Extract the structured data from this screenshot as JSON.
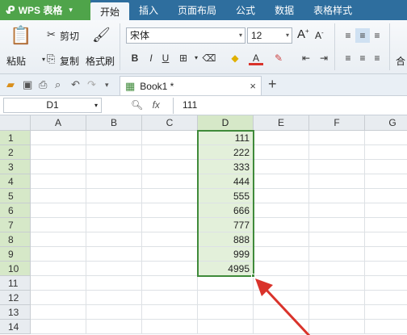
{
  "app": {
    "name": "WPS 表格"
  },
  "menu": [
    "开始",
    "插入",
    "页面布局",
    "公式",
    "数据",
    "表格样式"
  ],
  "ribbon": {
    "paste": "粘贴",
    "cut": "剪切",
    "copy": "复制",
    "format_painter": "格式刷",
    "font_name": "宋体",
    "font_size": "12",
    "grow": "A",
    "shrink": "A",
    "bold": "B",
    "italic": "I",
    "underline": "U",
    "font_color": "A",
    "merge": "合"
  },
  "tabs": {
    "doc_name": "Book1 *",
    "close": "×",
    "new": "+"
  },
  "formula_bar": {
    "cell_ref": "D1",
    "fx": "fx",
    "value": "111"
  },
  "grid": {
    "columns": [
      "A",
      "B",
      "C",
      "D",
      "E",
      "F",
      "G"
    ],
    "rows": [
      "1",
      "2",
      "3",
      "4",
      "5",
      "6",
      "7",
      "8",
      "9",
      "10",
      "11",
      "12",
      "13",
      "14"
    ],
    "d_values": [
      "111",
      "222",
      "333",
      "444",
      "555",
      "666",
      "777",
      "888",
      "999",
      "4995"
    ]
  },
  "colors": {
    "accent": "#2e6e9e",
    "app_button": "#4fa44a",
    "selection": "#3f8a3a",
    "arrow": "#d9332b"
  }
}
